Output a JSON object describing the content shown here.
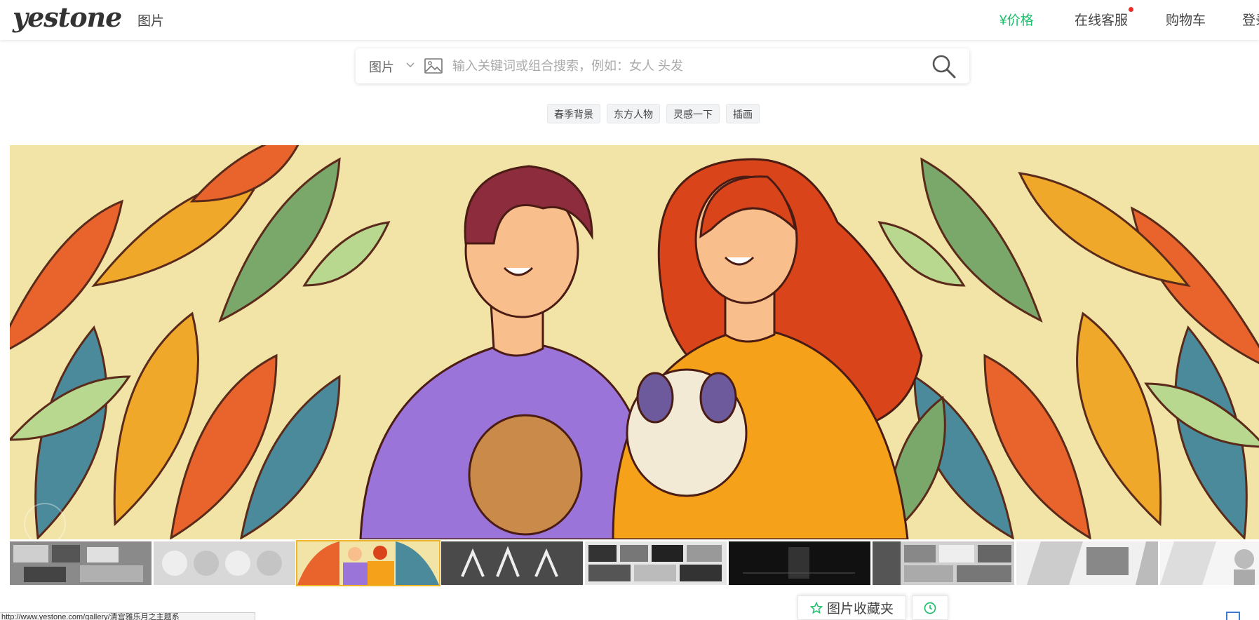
{
  "header": {
    "logo": "yestone",
    "nav_left": "图片",
    "nav_price": "¥价格",
    "nav_service": "在线客服",
    "nav_cart": "购物车",
    "nav_login": "登录"
  },
  "search": {
    "type_label": "图片",
    "placeholder": "输入关键词或组合搜索，例如：女人 头发"
  },
  "tags": [
    "春季背景",
    "东方人物",
    "灵感一下",
    "插画"
  ],
  "bottom": {
    "favorites_label": "图片收藏夹",
    "status_url": "http://www.yestone.com/gallery/清宫雅乐月之主题系"
  },
  "colors": {
    "accent_green": "#1bbf6b",
    "notification_red": "#ee2a2a",
    "active_thumb_border": "#f0b429"
  }
}
